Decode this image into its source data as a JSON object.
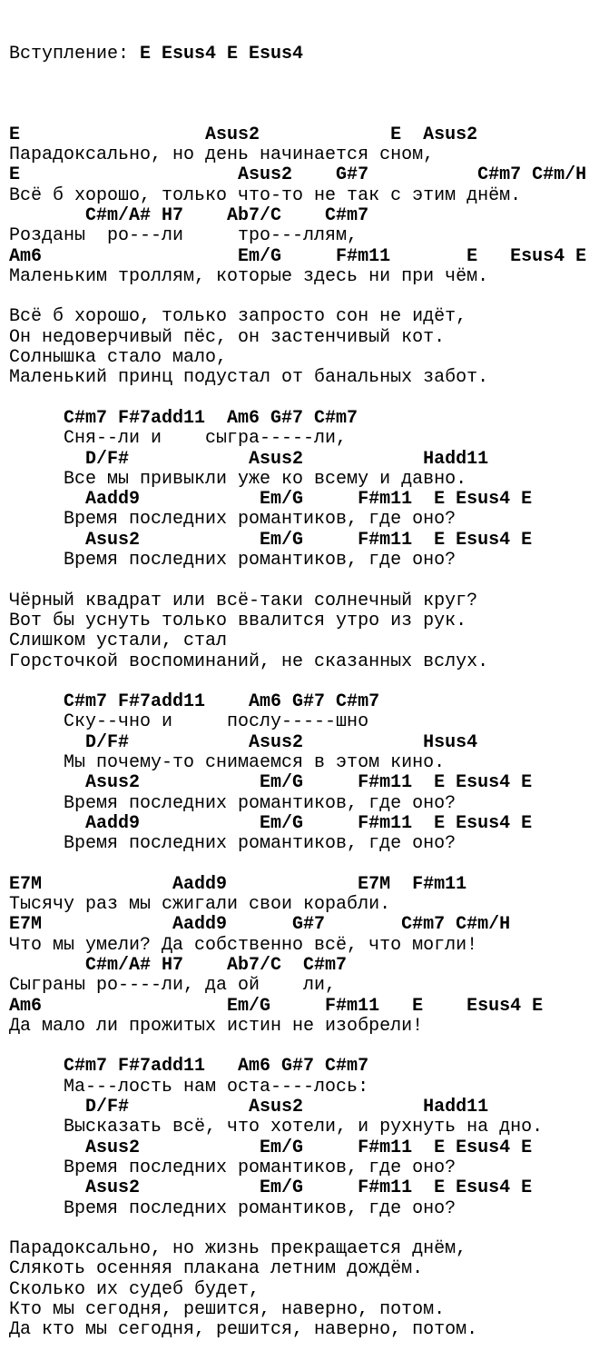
{
  "intro": {
    "label": "Вступление: ",
    "chords": "E Esus4 E Esus4"
  },
  "lines": [
    {
      "t": "b",
      "s": ""
    },
    {
      "t": "c",
      "s": "E                 Asus2            E  Asus2"
    },
    {
      "t": "l",
      "s": "Парадоксально, но день начинается сном,"
    },
    {
      "t": "c",
      "s": "E                    Asus2    G#7          C#m7 C#m/H"
    },
    {
      "t": "l",
      "s": "Всё б хорошо, только что-то не так с этим днём."
    },
    {
      "t": "c",
      "s": "       C#m/A# H7    Ab7/C    C#m7"
    },
    {
      "t": "l",
      "s": "Розданы  ро---ли     тро---ллям,"
    },
    {
      "t": "c",
      "s": "Am6                  Em/G     F#m11       E   Esus4 E"
    },
    {
      "t": "l",
      "s": "Маленьким троллям, которые здесь ни при чём."
    },
    {
      "t": "b",
      "s": ""
    },
    {
      "t": "l",
      "s": "Всё б хорошо, только запросто сон не идёт,"
    },
    {
      "t": "l",
      "s": "Он недоверчивый пёс, он застенчивый кот."
    },
    {
      "t": "l",
      "s": "Солнышка стало мало,"
    },
    {
      "t": "l",
      "s": "Маленький принц подустал от банальных забот."
    },
    {
      "t": "b",
      "s": ""
    },
    {
      "t": "c",
      "s": "     C#m7 F#7add11  Am6 G#7 C#m7"
    },
    {
      "t": "l",
      "s": "     Сня--ли и    сыгра-----ли,"
    },
    {
      "t": "c",
      "s": "       D/F#           Asus2           Hadd11"
    },
    {
      "t": "l",
      "s": "     Все мы привыкли уже ко всему и давно."
    },
    {
      "t": "c",
      "s": "       Aadd9           Em/G     F#m11  E Esus4 E"
    },
    {
      "t": "l",
      "s": "     Время последних романтиков, где оно?"
    },
    {
      "t": "c",
      "s": "       Asus2           Em/G     F#m11  E Esus4 E"
    },
    {
      "t": "l",
      "s": "     Время последних романтиков, где оно?"
    },
    {
      "t": "b",
      "s": ""
    },
    {
      "t": "l",
      "s": "Чёрный квадрат или всё-таки солнечный круг?"
    },
    {
      "t": "l",
      "s": "Вот бы уснуть только ввалится утро из рук."
    },
    {
      "t": "l",
      "s": "Слишком устали, стал"
    },
    {
      "t": "l",
      "s": "Горсточкой воспоминаний, не сказанных вслух."
    },
    {
      "t": "b",
      "s": ""
    },
    {
      "t": "c",
      "s": "     C#m7 F#7add11    Am6 G#7 C#m7"
    },
    {
      "t": "l",
      "s": "     Ску--чно и     послу-----шно"
    },
    {
      "t": "c",
      "s": "       D/F#           Asus2           Hsus4"
    },
    {
      "t": "l",
      "s": "     Мы почему-то снимаемся в этом кино."
    },
    {
      "t": "c",
      "s": "       Asus2           Em/G     F#m11  E Esus4 E"
    },
    {
      "t": "l",
      "s": "     Время последних романтиков, где оно?"
    },
    {
      "t": "c",
      "s": "       Aadd9           Em/G     F#m11  E Esus4 E"
    },
    {
      "t": "l",
      "s": "     Время последних романтиков, где оно?"
    },
    {
      "t": "b",
      "s": ""
    },
    {
      "t": "c",
      "s": "E7M            Aadd9            E7M  F#m11"
    },
    {
      "t": "l",
      "s": "Тысячу раз мы сжигали свои корабли."
    },
    {
      "t": "c",
      "s": "E7M            Aadd9      G#7       C#m7 C#m/H"
    },
    {
      "t": "l",
      "s": "Что мы умели? Да собственно всё, что могли!"
    },
    {
      "t": "c",
      "s": "       C#m/A# H7    Ab7/C  C#m7"
    },
    {
      "t": "l",
      "s": "Сыграны ро----ли, да ой    ли,"
    },
    {
      "t": "c",
      "s": "Am6                 Em/G     F#m11   E    Esus4 E"
    },
    {
      "t": "l",
      "s": "Да мало ли прожитых истин не изобрели!"
    },
    {
      "t": "b",
      "s": ""
    },
    {
      "t": "c",
      "s": "     C#m7 F#7add11   Am6 G#7 C#m7"
    },
    {
      "t": "l",
      "s": "     Ма---лость нам оста----лось:"
    },
    {
      "t": "c",
      "s": "       D/F#           Asus2           Hadd11"
    },
    {
      "t": "l",
      "s": "     Высказать всё, что хотели, и рухнуть на дно."
    },
    {
      "t": "c",
      "s": "       Asus2           Em/G     F#m11  E Esus4 E"
    },
    {
      "t": "l",
      "s": "     Время последних романтиков, где оно?"
    },
    {
      "t": "c",
      "s": "       Asus2           Em/G     F#m11  E Esus4 E"
    },
    {
      "t": "l",
      "s": "     Время последних романтиков, где оно?"
    },
    {
      "t": "b",
      "s": ""
    },
    {
      "t": "l",
      "s": "Парадоксально, но жизнь прекращается днём,"
    },
    {
      "t": "l",
      "s": "Слякоть осенняя плакана летним дождём."
    },
    {
      "t": "l",
      "s": "Сколько их судеб будет,"
    },
    {
      "t": "l",
      "s": "Кто мы сегодня, решится, наверно, потом."
    },
    {
      "t": "l",
      "s": "Да кто мы сегодня, решится, наверно, потом."
    }
  ]
}
